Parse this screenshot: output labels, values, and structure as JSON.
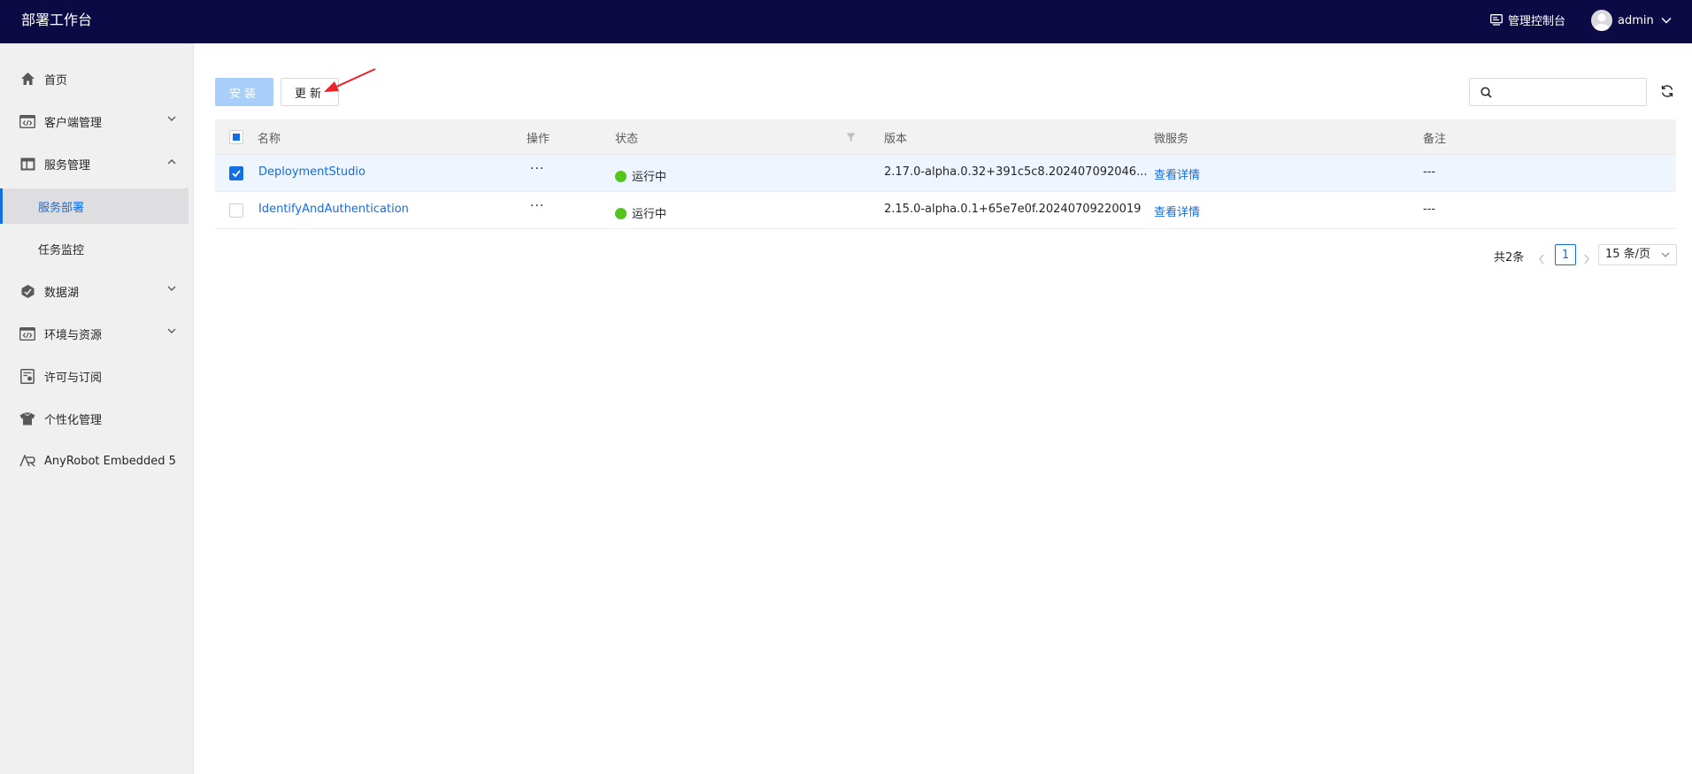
{
  "header": {
    "app_title": "部署工作台",
    "admin_console_label": "管理控制台",
    "username": "admin"
  },
  "sidebar": {
    "items": [
      {
        "label": "首页",
        "icon": "home-icon"
      },
      {
        "label": "客户端管理",
        "icon": "code-window-icon",
        "expandable": true,
        "expanded": false
      },
      {
        "label": "服务管理",
        "icon": "layout-icon",
        "expandable": true,
        "expanded": true
      },
      {
        "label": "服务部署",
        "sub": true,
        "active": true
      },
      {
        "label": "任务监控",
        "sub": true
      },
      {
        "label": "数据湖",
        "icon": "hexagon-icon",
        "expandable": true,
        "expanded": false
      },
      {
        "label": "环境与资源",
        "icon": "code-window-icon",
        "expandable": true,
        "expanded": false
      },
      {
        "label": "许可与订阅",
        "icon": "license-icon"
      },
      {
        "label": "个性化管理",
        "icon": "shirt-icon"
      },
      {
        "label": "AnyRobot Embedded 5",
        "icon": "anyrobot-logo-icon"
      }
    ]
  },
  "toolbar": {
    "install_label": "安装",
    "update_label": "更新",
    "search_placeholder": "",
    "search_value": ""
  },
  "table": {
    "columns": [
      "名称",
      "操作",
      "状态",
      "版本",
      "微服务",
      "备注"
    ],
    "rows": [
      {
        "checked": true,
        "name": "DeploymentStudio",
        "actions": "···",
        "status": "运行中",
        "version": "2.17.0-alpha.0.32+391c5c8.202407092046...",
        "microservice": "查看详情",
        "remark": "---"
      },
      {
        "checked": false,
        "name": "IdentifyAndAuthentication",
        "actions": "···",
        "status": "运行中",
        "version": "2.15.0-alpha.0.1+65e7e0f.20240709220019",
        "microservice": "查看详情",
        "remark": "---"
      }
    ]
  },
  "pagination": {
    "total_text": "共2条",
    "current_page": "1",
    "page_size": "15 条/页"
  },
  "colors": {
    "header_bg": "#0b0a45",
    "primary": "#126ee3",
    "status_running": "#52c41a",
    "annotation_arrow": "#e8232a"
  }
}
